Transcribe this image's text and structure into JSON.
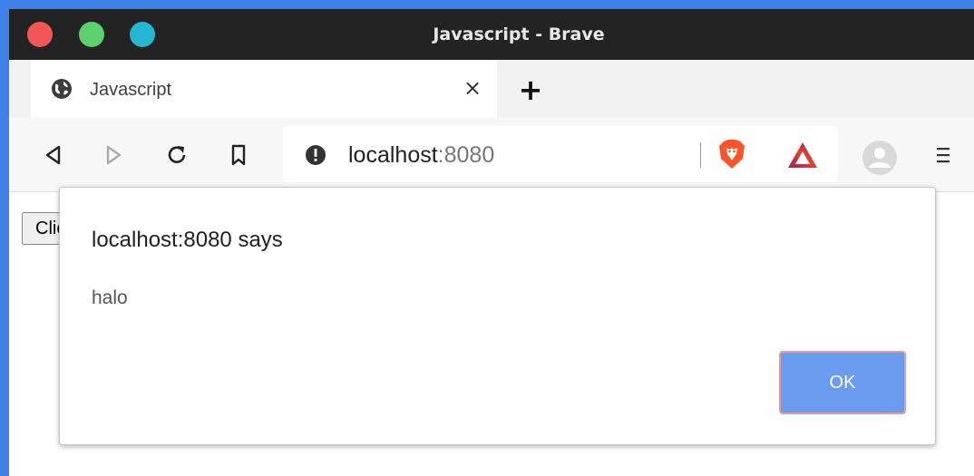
{
  "window": {
    "title": "Javascript - Brave"
  },
  "tabs": [
    {
      "title": "Javascript",
      "close": "×"
    }
  ],
  "new_tab": "+",
  "address_bar": {
    "host": "localhost",
    "port": ":8080"
  },
  "page": {
    "button_label": "Click"
  },
  "dialog": {
    "title": "localhost:8080 says",
    "message": "halo",
    "ok_label": "OK"
  },
  "colors": {
    "desktop_background": "#3f7fe8",
    "titlebar": "#232323",
    "close_dot": "#f25757",
    "maximize_dot": "#5ccf6e",
    "minimize_dot": "#25b7cf",
    "ok_button": "#6b9cf0",
    "brave_lion": "#fb542b"
  },
  "icons": {
    "tab": "globe-icon",
    "toolbar": [
      "back-icon",
      "forward-icon",
      "reload-icon",
      "bookmark-icon"
    ],
    "address": "info-icon",
    "extensions": [
      "brave-shields-icon",
      "brave-rewards-icon"
    ],
    "profile": "avatar-icon",
    "menu": "hamburger-menu-icon"
  }
}
